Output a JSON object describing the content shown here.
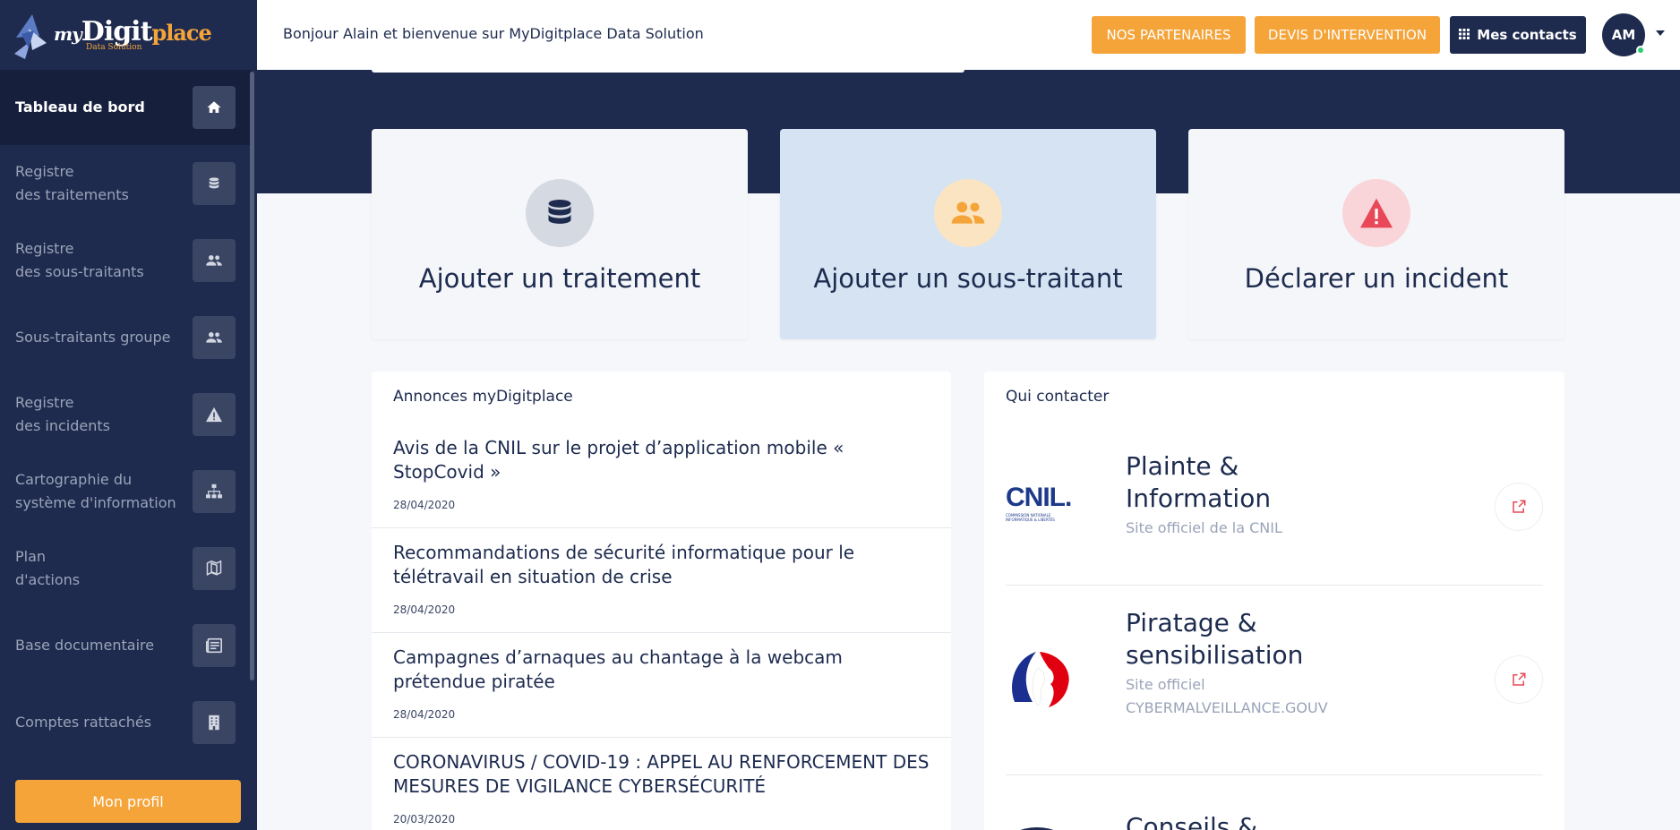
{
  "logo": {
    "my": "my",
    "brand": "Digit",
    "place": "place",
    "sub": "Data Solution"
  },
  "sidebar": {
    "items": [
      {
        "line1": "Tableau de bord",
        "line2": "",
        "icon": "home-icon"
      },
      {
        "line1": "Registre",
        "line2": "des traitements",
        "icon": "database-icon"
      },
      {
        "line1": "Registre",
        "line2": "des sous-traitants",
        "icon": "users-icon"
      },
      {
        "line1": "Sous-traitants groupe",
        "line2": "",
        "icon": "users-icon"
      },
      {
        "line1": "Registre",
        "line2": "des incidents",
        "icon": "warning-icon"
      },
      {
        "line1": "Cartographie du",
        "line2": "système d'information",
        "icon": "sitemap-icon"
      },
      {
        "line1": "Plan",
        "line2": "d'actions",
        "icon": "map-icon"
      },
      {
        "line1": "Base documentaire",
        "line2": "",
        "icon": "newspaper-icon"
      },
      {
        "line1": "Comptes rattachés",
        "line2": "",
        "icon": "building-icon"
      }
    ],
    "profile_label": "Mon profil"
  },
  "header": {
    "greeting": "Bonjour Alain et bienvenue sur MyDigitplace Data Solution",
    "partners_label": "NOS PARTENAIRES",
    "devis_label": "DEVIS D'INTERVENTION",
    "contacts_label": "Mes contacts",
    "avatar_initials": "AM"
  },
  "actions": [
    {
      "title": "Ajouter un traitement",
      "icon": "database-icon"
    },
    {
      "title": "Ajouter un sous-traitant",
      "icon": "users-icon"
    },
    {
      "title": "Déclarer un incident",
      "icon": "warning-icon"
    }
  ],
  "news": {
    "title": "Annonces myDigitplace",
    "items": [
      {
        "title": "Avis de la CNIL sur le projet d’application mobile « StopCovid »",
        "date": "28/04/2020"
      },
      {
        "title": "Recommandations de sécurité informatique pour le télétravail en situation de crise",
        "date": "28/04/2020"
      },
      {
        "title": "Campagnes d’arnaques au chantage à la webcam prétendue piratée",
        "date": "28/04/2020"
      },
      {
        "title": "CORONAVIRUS / COVID-19 : APPEL AU RENFORCEMENT DES MESURES DE VIGILANCE CYBERSÉCURITÉ",
        "date": "20/03/2020"
      }
    ]
  },
  "contacts": {
    "title": "Qui contacter",
    "items": [
      {
        "title1": "Plainte &",
        "title2": "Information",
        "sub1": "Site officiel de la CNIL",
        "sub2": "",
        "logo": "cnil-logo",
        "logo_text": "CNIL.",
        "logo_small": "COMMISSION NATIONALE INFORMATIQUE & LIBERTÉS"
      },
      {
        "title1": "Piratage &",
        "title2": "sensibilisation",
        "sub1": "Site officiel",
        "sub2": "CYBERMALVEILLANCE.GOUV",
        "logo": "marianne-logo"
      },
      {
        "title1": "Conseils &",
        "title2": "",
        "sub1": "",
        "sub2": "",
        "logo": "gov-logo"
      }
    ]
  },
  "colors": {
    "navy": "#1f2b4e",
    "orange": "#f5a43a",
    "red": "#e84857"
  }
}
